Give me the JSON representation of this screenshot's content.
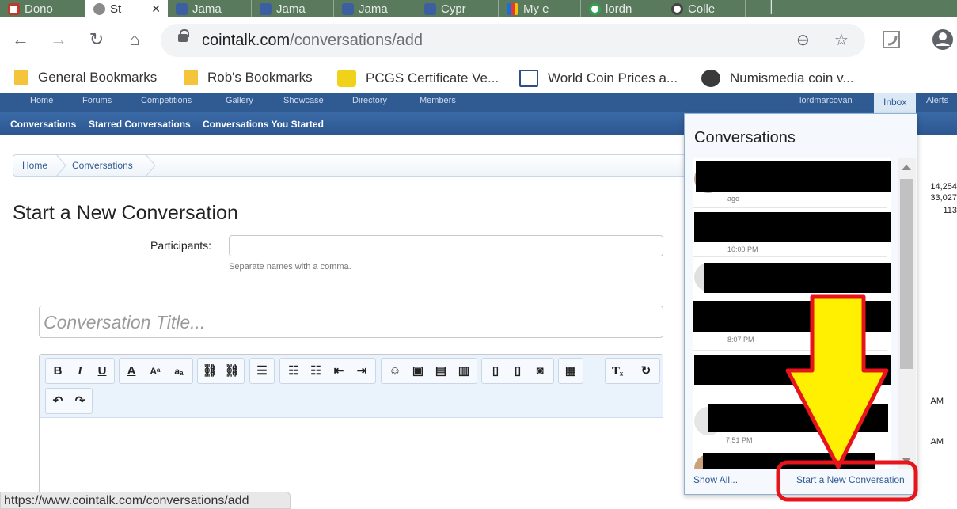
{
  "browser": {
    "tabs": [
      {
        "label": "Dono",
        "color": "#c0392b"
      },
      {
        "label": "St",
        "color": "#8a8a8a"
      },
      {
        "label": "Jama",
        "color": "#3b5fa0"
      },
      {
        "label": "Jama",
        "color": "#3b5fa0"
      },
      {
        "label": "Jama",
        "color": "#3b5fa0"
      },
      {
        "label": "Cypr",
        "color": "#3b5fa0"
      },
      {
        "label": "My e",
        "color": "#2a7d2a"
      },
      {
        "label": "lordn",
        "color": "#2ea44f"
      },
      {
        "label": "Colle",
        "color": "#444444"
      }
    ],
    "url_host": "cointalk.com",
    "url_path": "/conversations/add",
    "bookmarks": [
      {
        "label": "General Bookmarks",
        "icon": "folder-icon"
      },
      {
        "label": "Rob's Bookmarks",
        "icon": "folder-icon"
      },
      {
        "label": "PCGS Certificate Ve...",
        "icon": "pcgs-shield-icon"
      },
      {
        "label": "World Coin Prices a...",
        "icon": "scales-icon"
      },
      {
        "label": "Numismedia coin v...",
        "icon": "coin-icon"
      }
    ],
    "status_url": "https://www.cointalk.com/conversations/add"
  },
  "site": {
    "nav": [
      "Home",
      "Forums",
      "Competitions",
      "Gallery",
      "Showcase",
      "Directory",
      "Members"
    ],
    "username": "lordmarcovan",
    "inbox_label": "Inbox",
    "alerts_label": "Alerts",
    "subnav": [
      "Conversations",
      "Starred Conversations",
      "Conversations You Started"
    ],
    "breadcrumbs": [
      "Home",
      "Conversations"
    ]
  },
  "form": {
    "title": "Start a New Conversation",
    "participants_label": "Participants:",
    "participants_value": "",
    "participants_hint": "Separate names with a comma.",
    "title_placeholder": "Conversation Title..."
  },
  "side_stats": [
    "14,254",
    "33,027",
    "113",
    "AM",
    "AM"
  ],
  "conversations_panel": {
    "title": "Conversations",
    "items": [
      {
        "time": "ago"
      },
      {
        "time": "10:00 PM"
      },
      {
        "time": ""
      },
      {
        "time": "8:07 PM"
      },
      {
        "time": ""
      },
      {
        "time": "7:51 PM"
      },
      {
        "time": ""
      }
    ],
    "show_all": "Show All...",
    "start_new": "Start a New Conversation"
  },
  "annotation": {
    "arrow_color": "#ffef00",
    "outline_color": "#e8141b"
  }
}
